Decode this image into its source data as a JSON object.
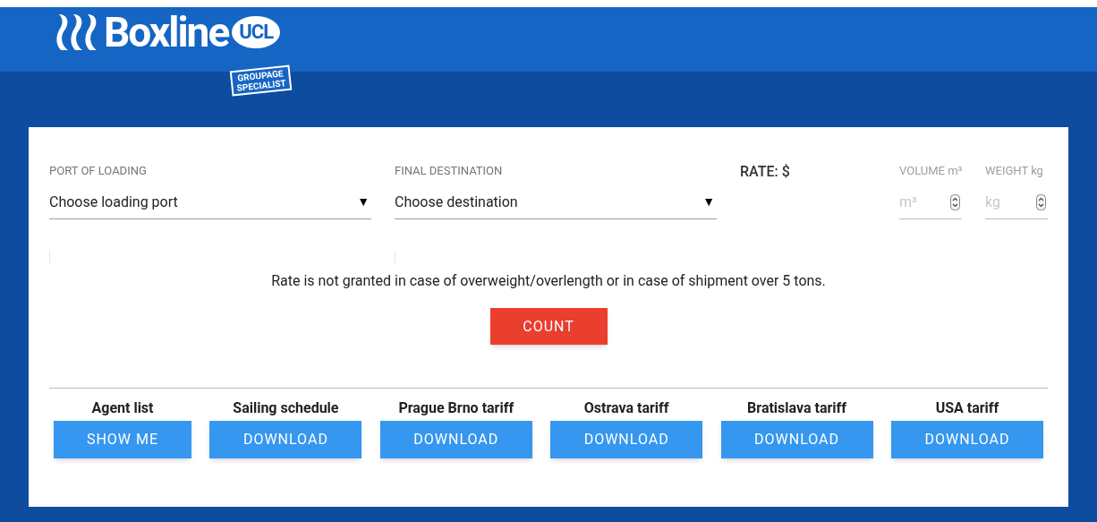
{
  "logo": {
    "name": "Boxline",
    "badge": "UCL",
    "tagline": [
      "GROUPAGE",
      "SPECIALIST"
    ]
  },
  "form": {
    "fields": [
      {
        "kind": "select",
        "label": "PORT OF LOADING",
        "value": "Choose loading port",
        "caret": "▼"
      },
      {
        "kind": "select",
        "label": "FINAL DESTINATION",
        "value": "Choose destination",
        "caret": "▼"
      },
      {
        "kind": "rate",
        "label": "RATE: $"
      },
      {
        "kind": "number",
        "label": "VOLUME m³",
        "placeholder": "m³"
      },
      {
        "kind": "number",
        "label": "WEIGHT kg",
        "placeholder": "kg"
      }
    ],
    "notice": "Rate is not granted in case of overweight/overlength or in case of shipment over 5 tons.",
    "button": "COUNT"
  },
  "downloads": [
    {
      "title": "Agent list",
      "button": "SHOW ME"
    },
    {
      "title": "Sailing schedule",
      "button": "DOWNLOAD"
    },
    {
      "title": "Prague Brno tariff",
      "button": "DOWNLOAD"
    },
    {
      "title": "Ostrava tariff",
      "button": "DOWNLOAD"
    },
    {
      "title": "Bratislava tariff",
      "button": "DOWNLOAD"
    },
    {
      "title": "USA tariff",
      "button": "DOWNLOAD"
    }
  ]
}
